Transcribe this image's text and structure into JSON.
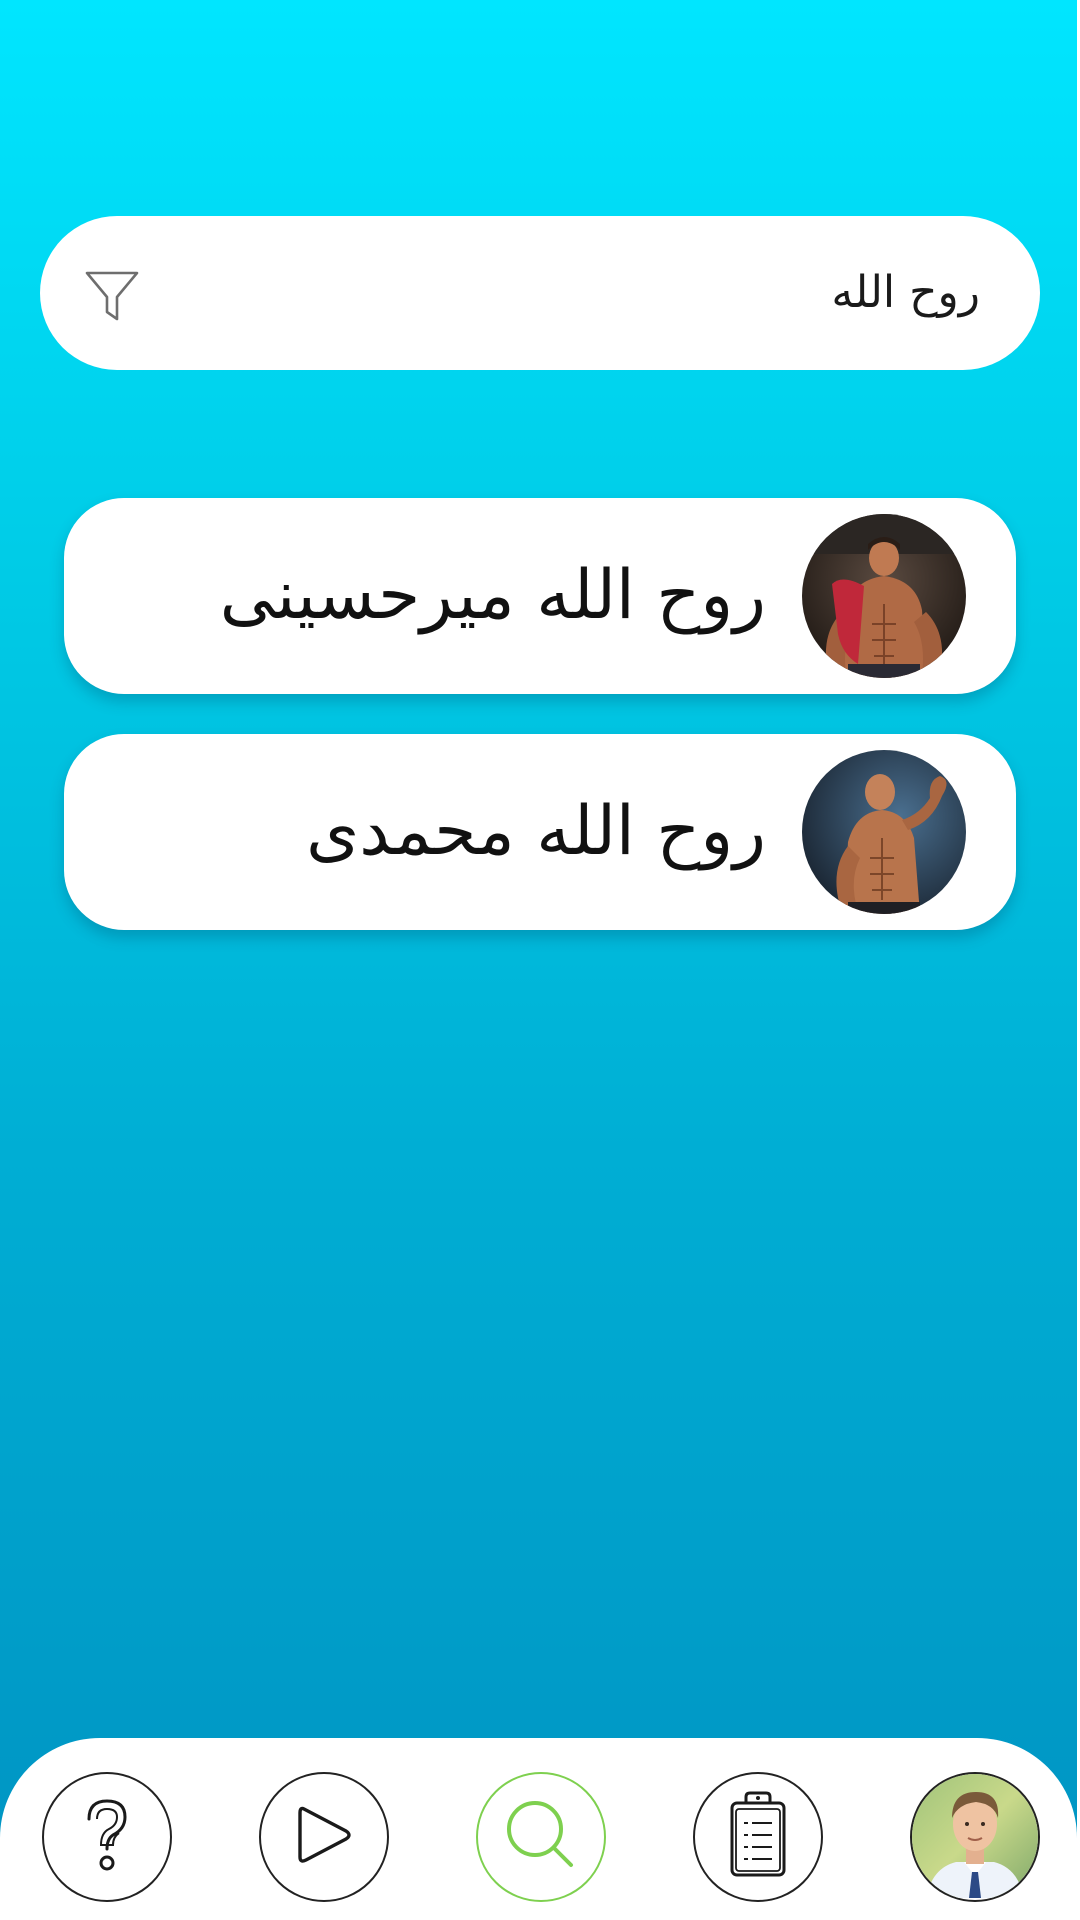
{
  "search": {
    "query": "روح الله",
    "filter_icon": "filter-icon"
  },
  "results": [
    {
      "name": "روح الله میرحسینی",
      "avatar": "avatar-bodybuilder-red-towel"
    },
    {
      "name": "روح الله محمدی",
      "avatar": "avatar-bodybuilder-flexing"
    }
  ],
  "nav": {
    "items": [
      {
        "icon": "question-mark-icon",
        "active": false
      },
      {
        "icon": "play-icon",
        "active": false
      },
      {
        "icon": "search-icon",
        "active": true
      },
      {
        "icon": "clipboard-icon",
        "active": false
      },
      {
        "icon": "profile-avatar",
        "active": false
      }
    ]
  },
  "colors": {
    "background_top": "#00e6ff",
    "background_bottom": "#0093c2",
    "active_accent": "#7ed04f",
    "card_background": "#ffffff"
  }
}
